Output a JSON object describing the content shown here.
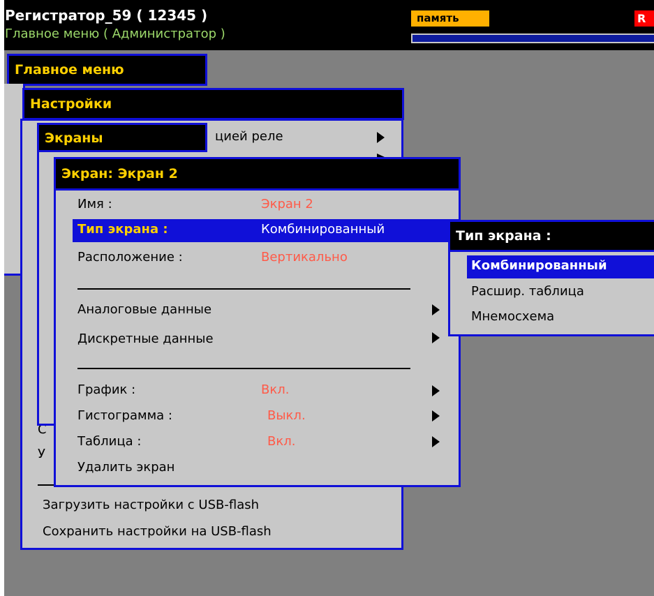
{
  "header": {
    "title": "Регистратор_59 ( 12345 )",
    "subtitle": "Главное меню ( Администратор )",
    "memory_label": "память",
    "status_badge": "R",
    "progress_percent": 98
  },
  "main_menu": {
    "title": "Главное меню"
  },
  "settings_menu": {
    "title": "Настройки",
    "partial_item": "цией реле",
    "bottom_fragment_1": "С",
    "bottom_fragment_2": "У",
    "load_usb": "Загрузить настройки с USB-flash",
    "save_usb": "Сохранить настройки на USB-flash"
  },
  "screens_menu": {
    "title": "Экраны"
  },
  "screen_menu": {
    "title": "Экран: Экран 2",
    "name_label": "Имя :",
    "name_value": "Экран 2",
    "type_label": "Тип экрана :",
    "type_value": "Комбинированный",
    "layout_label": "Расположение :",
    "layout_value": "Вертикально",
    "analog": "Аналоговые данные",
    "discrete": "Дискретные данные",
    "graph_label": "График :",
    "graph_value": "Вкл.",
    "histogram_label": "Гистограмма :",
    "histogram_value": "Выкл.",
    "table_label": "Таблица :",
    "table_value": "Вкл.",
    "delete": "Удалить экран"
  },
  "type_popup": {
    "title": "Тип экрана :",
    "options": [
      "Комбинированный",
      "Расшир. таблица",
      "Мнемосхема"
    ],
    "selected_index": 0
  },
  "colors": {
    "window_border": "#1010d8",
    "title_text": "#ffd000",
    "value_text": "#ff5a48",
    "highlight": "#1010d8",
    "memory_badge": "#ffb000"
  },
  "icons": [
    "submenu-arrow-icon"
  ]
}
